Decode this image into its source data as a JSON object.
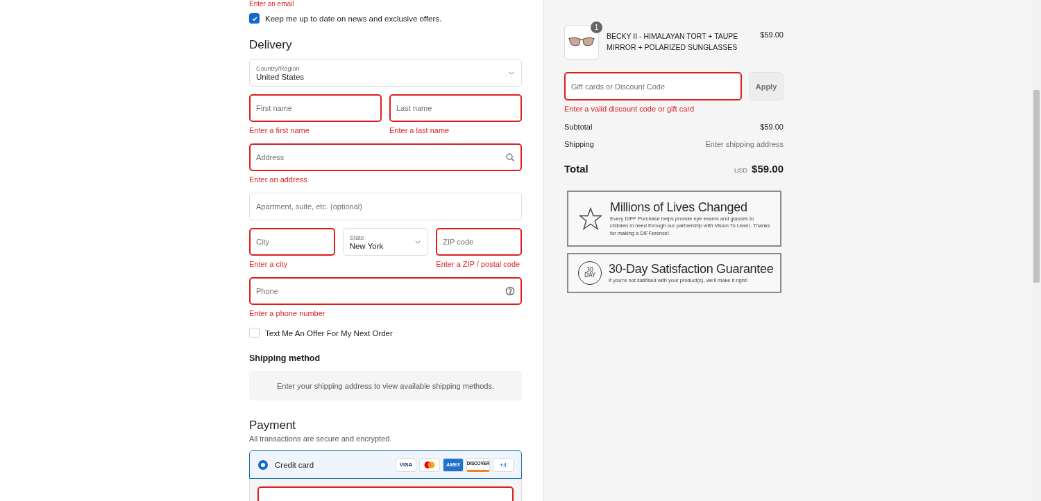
{
  "contact": {
    "email_error": "Enter an email",
    "newsletter": {
      "label": "Keep me up to date on news and exclusive offers.",
      "checked": true
    }
  },
  "delivery": {
    "title": "Delivery",
    "rows": [
      [
        {
          "kind": "select",
          "label": "Country/Region",
          "value": "United States"
        }
      ],
      [
        {
          "kind": "input",
          "placeholder": "First name",
          "invalid": true,
          "error": "Enter a first name"
        },
        {
          "kind": "input",
          "placeholder": "Last name",
          "invalid": true,
          "error": "Enter a last name"
        }
      ],
      [
        {
          "kind": "search_input",
          "placeholder": "Address",
          "invalid": true,
          "error": "Enter an address"
        }
      ],
      [
        {
          "kind": "input",
          "placeholder": "Apartment, suite, etc. (optional)",
          "invalid": false
        }
      ],
      [
        {
          "kind": "input",
          "placeholder": "City",
          "invalid": true,
          "error": "Enter a city"
        },
        {
          "kind": "select",
          "label": "State",
          "value": "New York"
        },
        {
          "kind": "input",
          "placeholder": "ZIP code",
          "invalid": true,
          "error": "Enter a ZIP / postal code"
        }
      ],
      [
        {
          "kind": "phone_input",
          "placeholder": "Phone",
          "invalid": true,
          "error": "Enter a phone number"
        }
      ]
    ],
    "sms": {
      "label": "Text Me An Offer For My Next Order",
      "checked": false
    }
  },
  "shipping_method": {
    "title": "Shipping method",
    "message": "Enter your shipping address to view available shipping methods."
  },
  "payment": {
    "title": "Payment",
    "subtitle": "All transactions are secure and encrypted.",
    "methods": [
      {
        "label": "Credit card",
        "selected": true,
        "cards": [
          {
            "kind": "visa",
            "label": "VISA"
          },
          {
            "kind": "mastercard"
          },
          {
            "kind": "amex",
            "label": "AMEX"
          },
          {
            "kind": "discover",
            "label": "DISCOVER"
          },
          {
            "kind": "more",
            "label": "+4"
          }
        ],
        "card_field_invalid": true
      }
    ]
  },
  "order": {
    "items": [
      {
        "quantity": "1",
        "name": "BECKY II - HIMALAYAN TORT + TAUPE MIRROR + POLARIZED SUNGLASSES",
        "price": "$59.00"
      }
    ],
    "discount": {
      "placeholder": "Gift cards or Discount Code",
      "invalid": true,
      "error": "Enter a valid discount code or gift card",
      "button": "Apply"
    },
    "lines": [
      {
        "label": "Subtotal",
        "value": "$59.00",
        "muted": false
      },
      {
        "label": "Shipping",
        "value": "Enter shipping address",
        "muted": true
      }
    ],
    "total": {
      "label": "Total",
      "currency": "USD",
      "amount": "$59.00"
    },
    "banners": [
      {
        "kind": "star",
        "title": "Millions of Lives Changed",
        "text": "Every DIFF Purchase helps provide eye exams and glasses to children in need through our partnership with Vision To Learn. Thanks for making a DIFFerence!"
      },
      {
        "kind": "days",
        "badge": [
          "30",
          "DAY"
        ],
        "title": "30-Day Satisfaction Guarantee",
        "text": "If you're not satifised with your product(s), we'll make it right!"
      }
    ]
  }
}
